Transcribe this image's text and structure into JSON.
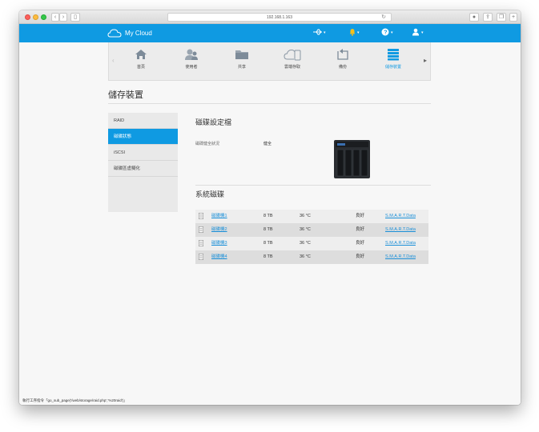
{
  "browser": {
    "url": "192.168.1.163",
    "status_bar": "執行工序指令「go_sub_page('/web/storage/raid.php','%20raid')」"
  },
  "header": {
    "logo_text": "My Cloud",
    "icons": [
      "usb-icon",
      "alert-icon",
      "help-icon",
      "user-icon"
    ]
  },
  "nav": {
    "items": [
      {
        "label": "首頁",
        "icon": "home-icon"
      },
      {
        "label": "使用者",
        "icon": "users-icon"
      },
      {
        "label": "共享",
        "icon": "share-icon"
      },
      {
        "label": "雲端存取",
        "icon": "cloud-access-icon"
      },
      {
        "label": "備份",
        "icon": "backup-icon"
      },
      {
        "label": "儲存裝置",
        "icon": "storage-icon",
        "active": true
      }
    ]
  },
  "page": {
    "title": "儲存裝置"
  },
  "sidebar": {
    "items": [
      {
        "label": "RAID"
      },
      {
        "label": "磁碟狀態",
        "active": true
      },
      {
        "label": "iSCSI"
      },
      {
        "label": "磁碟區虛擬化"
      }
    ]
  },
  "profile": {
    "title": "磁碟設定檔",
    "health_label": "磁碟健全狀況",
    "health_value": "健全"
  },
  "disks": {
    "title": "系統磁碟",
    "rows": [
      {
        "name": "磁碟機1",
        "size": "8 TB",
        "temp": "36 °C",
        "status": "良好",
        "smart": "S.M.A.R.T.Data"
      },
      {
        "name": "磁碟機2",
        "size": "8 TB",
        "temp": "36 °C",
        "status": "良好",
        "smart": "S.M.A.R.T.Data"
      },
      {
        "name": "磁碟機3",
        "size": "8 TB",
        "temp": "36 °C",
        "status": "良好",
        "smart": "S.M.A.R.T.Data"
      },
      {
        "name": "磁碟機4",
        "size": "8 TB",
        "temp": "36 °C",
        "status": "良好",
        "smart": "S.M.A.R.T.Data"
      }
    ]
  },
  "colors": {
    "accent": "#0f9ae2",
    "link": "#1a8fd8"
  }
}
